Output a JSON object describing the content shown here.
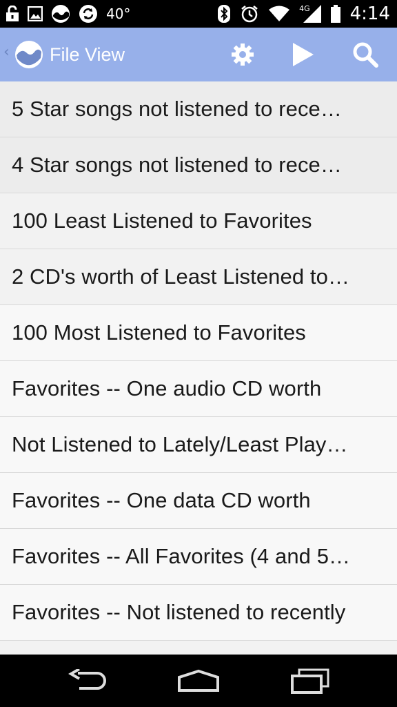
{
  "status_bar": {
    "temperature": "40°",
    "network": "4G",
    "time": "4:14",
    "icons": [
      "lock-icon",
      "image-icon",
      "weather-icon",
      "sync-icon",
      "bluetooth-icon",
      "alarm-icon",
      "wifi-icon",
      "signal-icon",
      "battery-icon"
    ]
  },
  "action_bar": {
    "title": "File View",
    "background": "#97b0ea",
    "icons": [
      "up-caret-icon",
      "app-logo-icon",
      "settings-gear-icon",
      "play-icon",
      "search-icon"
    ]
  },
  "list": {
    "items": [
      {
        "label": "5 Star songs not listened to rece…"
      },
      {
        "label": "4 Star songs not listened to rece…"
      },
      {
        "label": "100 Least Listened to Favorites"
      },
      {
        "label": "2 CD's worth of Least Listened to…"
      },
      {
        "label": "100 Most Listened to Favorites"
      },
      {
        "label": "Favorites -- One audio CD worth"
      },
      {
        "label": "Not Listened to Lately/Least Play…"
      },
      {
        "label": "Favorites -- One data CD worth"
      },
      {
        "label": "Favorites -- All Favorites (4 and 5…"
      },
      {
        "label": "Favorites -- Not listened to recently"
      }
    ]
  },
  "nav_bar": {
    "icons": [
      "back-icon",
      "home-icon",
      "recent-apps-icon"
    ]
  }
}
